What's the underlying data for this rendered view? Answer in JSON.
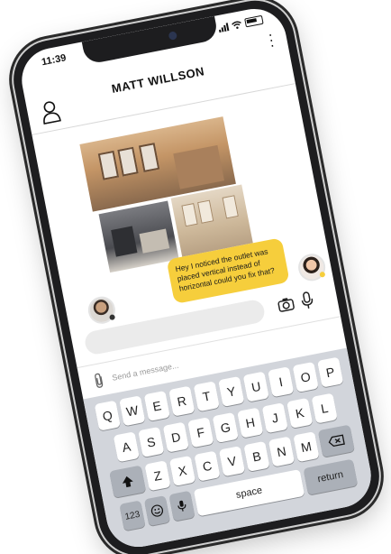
{
  "status_bar": {
    "time": "11:39"
  },
  "header": {
    "contact_name": "MATT WILLSON"
  },
  "messages": [
    {
      "text": "Hey I noticed the outlet was placed vertical instead of horizontal could you fix that?",
      "sender": "self",
      "bubble_color": "#f6ce3c"
    }
  ],
  "compose": {
    "placeholder": "Send a message..."
  },
  "keyboard": {
    "row1": [
      "Q",
      "W",
      "E",
      "R",
      "T",
      "Y",
      "U",
      "I",
      "O",
      "P"
    ],
    "row2": [
      "A",
      "S",
      "D",
      "F",
      "G",
      "H",
      "J",
      "K",
      "L"
    ],
    "row3": [
      "Z",
      "X",
      "C",
      "V",
      "B",
      "N",
      "M"
    ],
    "numbers_label": "123",
    "space_label": "space",
    "return_label": "return"
  }
}
